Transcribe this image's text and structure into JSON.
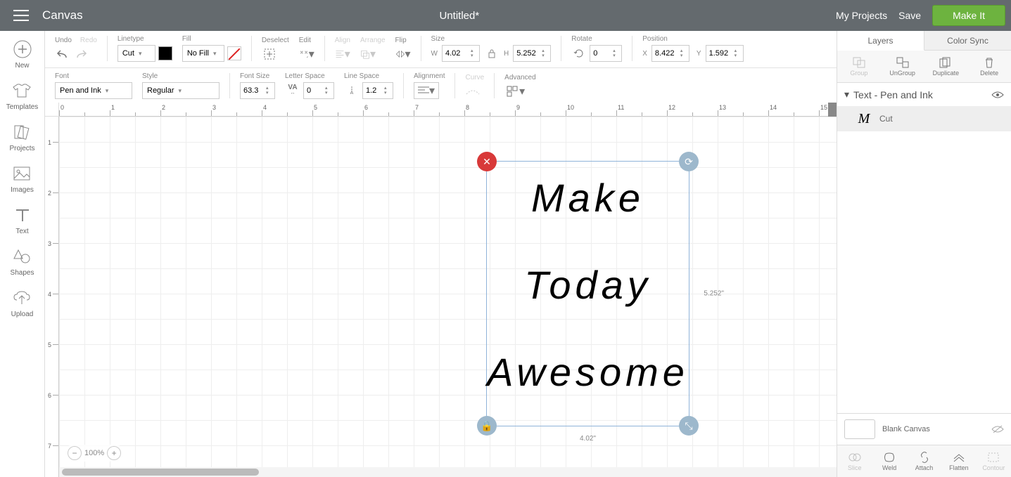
{
  "header": {
    "app": "Canvas",
    "title": "Untitled*",
    "my_projects": "My Projects",
    "save": "Save",
    "make_it": "Make It"
  },
  "sidebar": {
    "new": "New",
    "templates": "Templates",
    "projects": "Projects",
    "images": "Images",
    "text": "Text",
    "shapes": "Shapes",
    "upload": "Upload"
  },
  "toolbar1": {
    "undo": "Undo",
    "redo": "Redo",
    "linetype": "Linetype",
    "linetype_val": "Cut",
    "fill": "Fill",
    "fill_val": "No Fill",
    "deselect": "Deselect",
    "edit": "Edit",
    "align": "Align",
    "arrange": "Arrange",
    "flip": "Flip",
    "size": "Size",
    "w_lbl": "W",
    "w_val": "4.02",
    "h_lbl": "H",
    "h_val": "5.252",
    "rotate": "Rotate",
    "rotate_val": "0",
    "position": "Position",
    "x_lbl": "X",
    "x_val": "8.422",
    "y_lbl": "Y",
    "y_val": "1.592"
  },
  "toolbar2": {
    "font": "Font",
    "font_val": "Pen and Ink",
    "style": "Style",
    "style_val": "Regular",
    "fontsize": "Font Size",
    "fontsize_val": "63.3",
    "letterspace": "Letter Space",
    "letterspace_val": "0",
    "linespace": "Line Space",
    "linespace_val": "1.2",
    "alignment": "Alignment",
    "curve": "Curve",
    "advanced": "Advanced"
  },
  "canvas": {
    "text_line1": "Make",
    "text_line2": "Today",
    "text_line3": "Awesome",
    "dim_w": "4.02\"",
    "dim_h": "5.252\"",
    "zoom": "100%"
  },
  "ruler_h": [
    "0",
    "1",
    "2",
    "3",
    "4",
    "5",
    "6",
    "7",
    "8",
    "9",
    "10",
    "11",
    "12",
    "13",
    "14",
    "15"
  ],
  "ruler_v": [
    "1",
    "2",
    "3",
    "4",
    "5",
    "6",
    "7"
  ],
  "right": {
    "tab_layers": "Layers",
    "tab_colorsync": "Color Sync",
    "group": "Group",
    "ungroup": "UnGroup",
    "duplicate": "Duplicate",
    "delete": "Delete",
    "layer_title": "Text - Pen and Ink",
    "layer_item": "Cut",
    "blank": "Blank Canvas",
    "slice": "Slice",
    "weld": "Weld",
    "attach": "Attach",
    "flatten": "Flatten",
    "contour": "Contour"
  }
}
